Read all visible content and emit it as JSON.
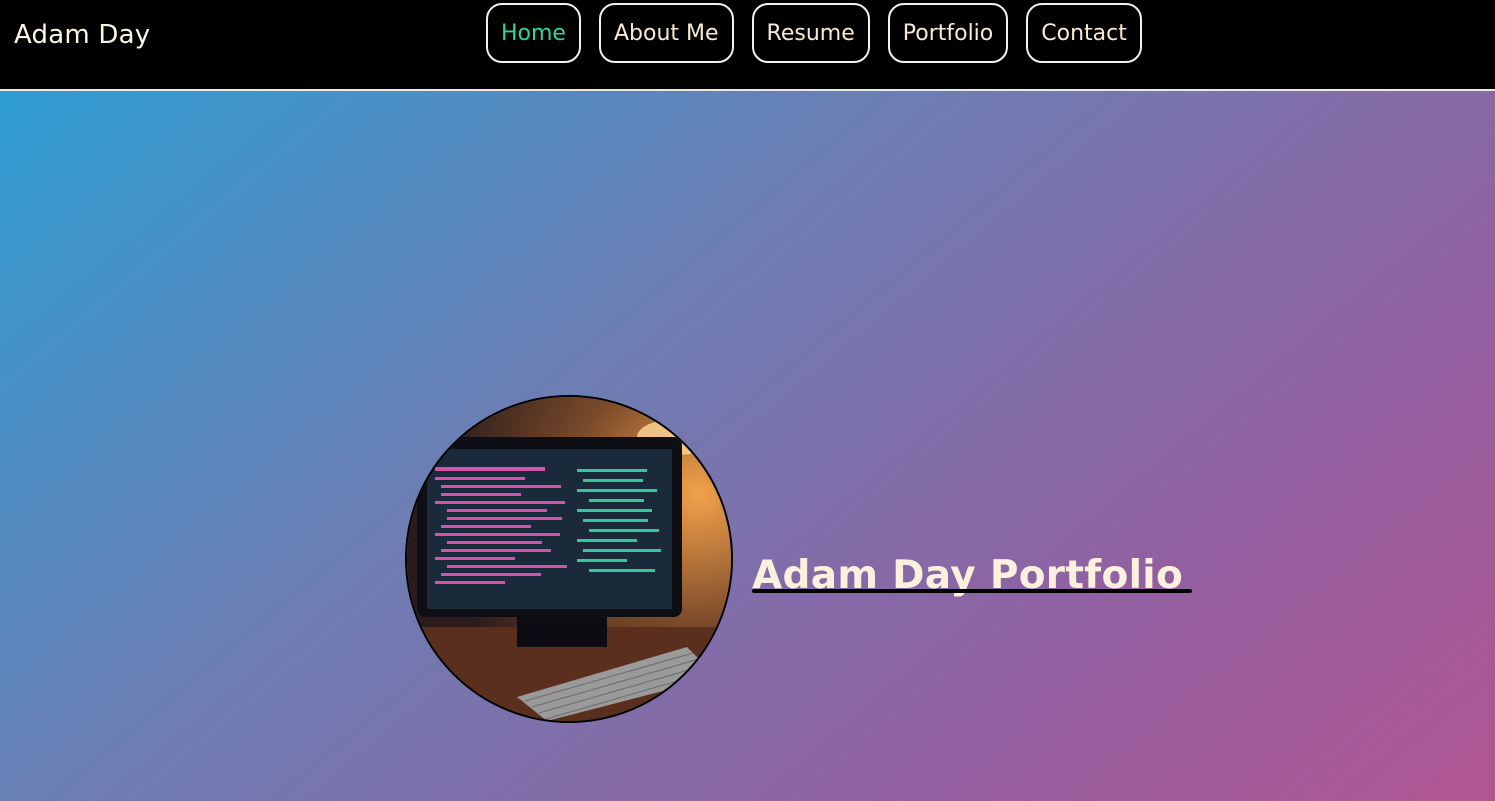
{
  "header": {
    "brand": "Adam Day",
    "nav": [
      {
        "label": "Home",
        "active": true
      },
      {
        "label": "About Me",
        "active": false
      },
      {
        "label": "Resume",
        "active": false
      },
      {
        "label": "Portfolio",
        "active": false
      },
      {
        "label": "Contact",
        "active": false
      }
    ],
    "active_color": "#31d49b",
    "text_color": "#f7ecd3"
  },
  "hero": {
    "title": "Adam Day Portfolio",
    "image": "computer-monitor-code-photo",
    "gradient": [
      "#2f9ed3",
      "#6e7db3",
      "#935fa0",
      "#b15693"
    ]
  }
}
